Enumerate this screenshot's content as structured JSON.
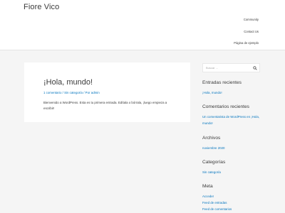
{
  "site": {
    "title": "Fiore Vico"
  },
  "nav": {
    "items": [
      {
        "label": "Community"
      },
      {
        "label": "Contact Us"
      },
      {
        "label": "Página de ejemplo"
      }
    ]
  },
  "post": {
    "title": "¡Hola, mundo!",
    "meta": {
      "comments": "1 comentario",
      "separator": "/",
      "category": "Sin categoría",
      "author_prefix": "Por",
      "author": "admin"
    },
    "content_line1": "Bienvenido a WordPress. Esta es tu primera entrada. Edítala o bórrala, ¡luego empieza a",
    "content_line2": "escribir!"
  },
  "sidebar": {
    "search_placeholder": "Buscar …",
    "recent_posts": {
      "title": "Entradas recientes",
      "items": [
        "¡Hola, mundo!"
      ]
    },
    "recent_comments": {
      "title": "Comentarios recientes",
      "line1_author": "Un comentarista de WordPress",
      "line1_on": "en",
      "line1_post": "¡Hola,",
      "line2_post": "mundo!"
    },
    "archives": {
      "title": "Archivos",
      "items": [
        "noviembre 2020"
      ]
    },
    "categories": {
      "title": "Categorías",
      "items": [
        "Sin categoría"
      ]
    },
    "meta": {
      "title": "Meta",
      "items": [
        "Acceder",
        "Feed de entradas",
        "Feed de comentarios"
      ]
    }
  },
  "colors": {
    "link": "#0274be",
    "text": "#3a3a3a",
    "background": "#f5f5f5"
  }
}
